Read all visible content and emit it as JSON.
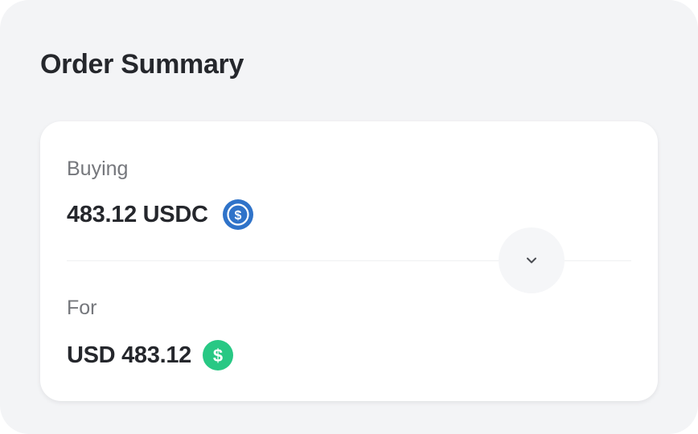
{
  "summary": {
    "title": "Order Summary"
  },
  "buying": {
    "label": "Buying",
    "amount": "483.12 USDC",
    "icon": "usdc-coin-icon",
    "icon_color": "#2f73c9"
  },
  "paying": {
    "label": "For",
    "amount": "USD 483.12",
    "icon": "usd-coin-icon",
    "icon_color": "#28c884"
  },
  "toggle": {
    "icon": "chevron-down-icon"
  }
}
